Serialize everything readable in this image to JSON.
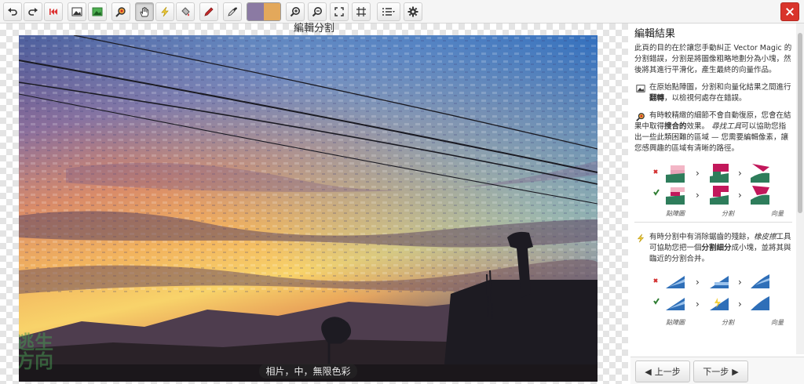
{
  "canvas": {
    "title": "編輯分割",
    "caption": "相片，中，無限色彩",
    "watermark_line1": "逃生",
    "watermark_line2": "方向"
  },
  "toolbar": {
    "tools": [
      "undo-icon",
      "redo-icon",
      "first-step-icon",
      "bitmap-view-icon",
      "result-view-icon",
      "find-problem-icon",
      "pan-hand-icon",
      "lightning-icon",
      "fill-icon",
      "pencil-icon",
      "eyedropper-icon",
      "zoom-in-icon",
      "zoom-out-icon",
      "fit-icon",
      "actual-size-icon",
      "list-menu-icon",
      "gear-icon",
      "close-icon"
    ],
    "swatch_left": "#8b7aa3",
    "swatch_right": "#e3a85b"
  },
  "side": {
    "title": "編輯結果",
    "intro": "此頁的目的在於讓您手動糾正 Vector Magic 的分割錯誤，分割是將圖像粗略地劃分為小塊，然後將其進行平滑化，產生最終的向量作品。",
    "tip1_a": "在原始點陣圖，分割和向量化結果之間進行",
    "tip1_b": "翻轉",
    "tip1_c": "，以檢視何處存在錯誤。",
    "tip2_a": "有時較精緻的細節不會自動復原，您會在結果中取得",
    "tip2_b": "搜合的",
    "tip2_c": "效果。",
    "tip2_d": "尋找工具",
    "tip2_e": "可以協助您指出一些此類困難的區域 — 您需要編輯像素，讓您感興趣的區域有清晰的路徑。",
    "tip3_a": "有時分割中有消除鋸齒的殘餘，",
    "tip3_b": "橡皮擦",
    "tip3_c": "工具可協助您把一個",
    "tip3_d": "分割細分",
    "tip3_e": "成小塊，並將其與臨近的分割合并。",
    "demo_labels": [
      "點陣圖",
      "分割",
      "向量"
    ],
    "prev_label": "上一步",
    "next_label": "下一步"
  }
}
